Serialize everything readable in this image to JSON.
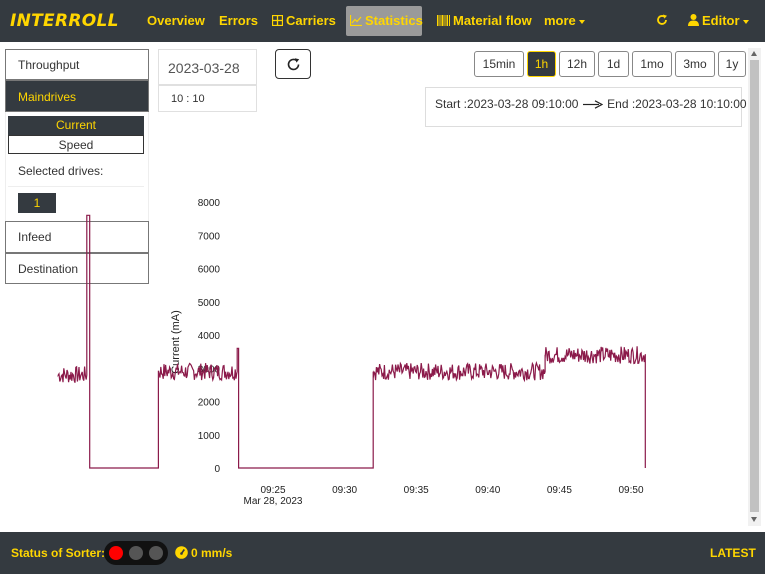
{
  "app": {
    "logo": "INTERROLL"
  },
  "nav": {
    "items": [
      {
        "label": "Overview"
      },
      {
        "label": "Errors"
      },
      {
        "label": "Carriers"
      },
      {
        "label": "Statistics"
      },
      {
        "label": "Material flow"
      },
      {
        "label": "more"
      }
    ],
    "refresh_icon": "refresh-icon",
    "user_label": "Editor",
    "accent": "#ffd600",
    "bg": "#343a40"
  },
  "sidebar": {
    "throughput": "Throughput",
    "maindrives": "Maindrives",
    "tab_current": "Current",
    "tab_speed": "Speed",
    "selected_drives_label": "Selected drives:",
    "selected_drive": "1",
    "infeed": "Infeed",
    "destination": "Destination"
  },
  "controls": {
    "date": "2023-03-28",
    "time": "10 : 10",
    "ranges": [
      "15min",
      "1h",
      "12h",
      "1d",
      "1mo",
      "3mo",
      "1y"
    ],
    "active_range": "1h",
    "start_label": "Start :",
    "start_value": "2023-03-28 09:10:00",
    "end_label": "End :",
    "end_value": "2023-03-28 10:10:00"
  },
  "chart_data": {
    "type": "line",
    "ylabel": "Current (mA)",
    "ylim": [
      0,
      8000
    ],
    "yticks": [
      "0",
      "1000",
      "2000",
      "3000",
      "4000",
      "5000",
      "6000",
      "7000",
      "8000"
    ],
    "xticks": [
      "09:25",
      "09:30",
      "09:35",
      "09:40",
      "09:45",
      "09:50"
    ],
    "xtick_sublabel": "Mar 28, 2023",
    "line_color": "#8b1a4a",
    "series": [
      {
        "x": [
          "09:10",
          "09:12",
          "09:12",
          "09:12.2",
          "09:12.2",
          "09:17",
          "09:17",
          "09:22.5",
          "09:22.5",
          "09:22.6",
          "09:22.6",
          "09:32",
          "09:32",
          "09:44",
          "09:44",
          "09:51",
          "09:51"
        ],
        "values": [
          2800,
          2800,
          7600,
          7600,
          0,
          0,
          2900,
          2900,
          3600,
          3600,
          0,
          0,
          2900,
          2900,
          3400,
          3400,
          0
        ]
      }
    ]
  },
  "footer": {
    "status_label": "Status of Sorter:",
    "speed": "0 mm/s",
    "latest": "LATEST",
    "light_colors": [
      "#ff0000",
      "#555555",
      "#555555"
    ]
  }
}
